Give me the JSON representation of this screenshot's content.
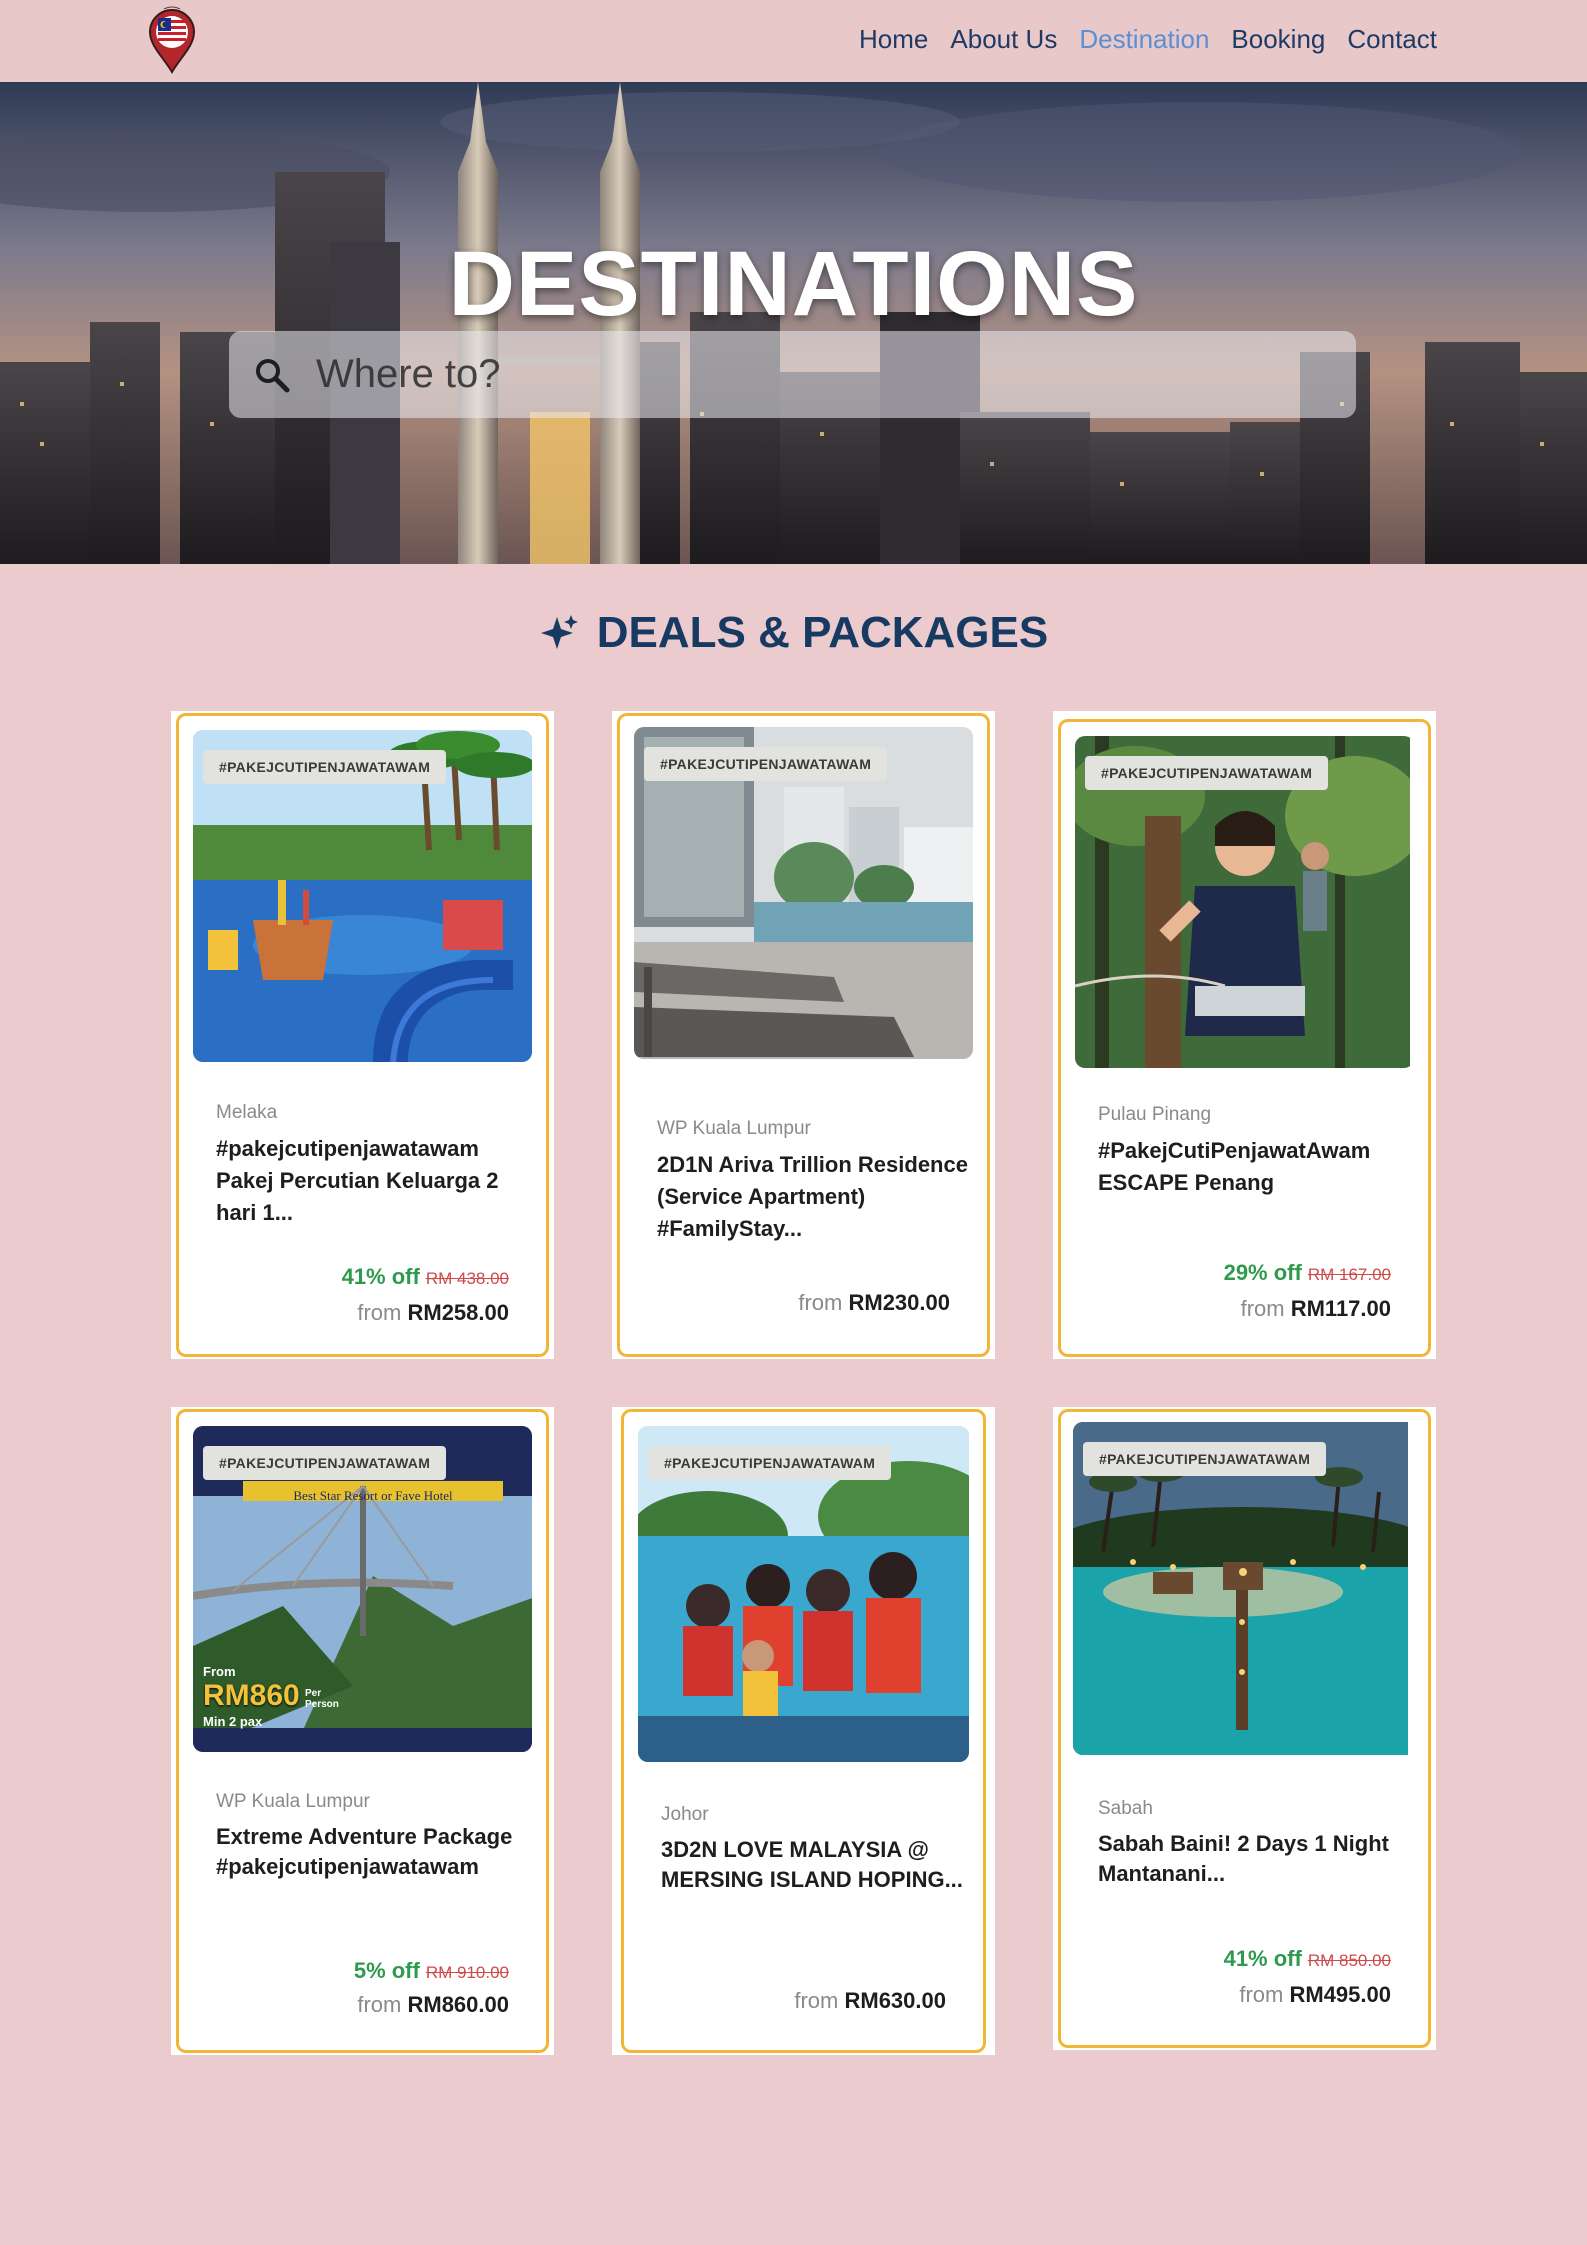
{
  "nav": {
    "links": [
      "Home",
      "About Us",
      "Destination",
      "Booking",
      "Contact"
    ],
    "active": "Destination"
  },
  "hero": {
    "title": "DESTINATIONS",
    "search_placeholder": "Where to?"
  },
  "section": {
    "title": "DEALS & PACKAGES"
  },
  "colors": {
    "accent": "#f2b636",
    "heading": "#173a63",
    "discount": "#2f9a4e",
    "strike": "#cf4a4a",
    "background": "#ebcbcd"
  },
  "cards": [
    {
      "tag": "#PAKEJCUTIPENJAWATAWAM",
      "location": "Melaka",
      "title": "#pakejcutipenjawatawam Pakej Percutian Keluarga 2 hari 1...",
      "discount": "41% off",
      "old_price": "RM 438.00",
      "from_label": "from",
      "price": "RM258.00",
      "image": "water-park"
    },
    {
      "tag": "#PAKEJCUTIPENJAWATAWAM",
      "location": "WP Kuala Lumpur",
      "title": "2D1N Ariva Trillion Residence (Service Apartment) #FamilyStay...",
      "discount": "",
      "old_price": "",
      "from_label": "from",
      "price": "RM230.00",
      "image": "pool-deck"
    },
    {
      "tag": "#PAKEJCUTIPENJAWATAWAM",
      "location": "Pulau Pinang",
      "title": "#PakejCutiPenjawatAwam ESCAPE Penang",
      "discount": "29% off",
      "old_price": "RM 167.00",
      "from_label": "from",
      "price": "RM117.00",
      "image": "forest-adventure"
    },
    {
      "tag": "#PAKEJCUTIPENJAWATAWAM",
      "location": "WP Kuala Lumpur",
      "title": "Extreme Adventure Package #pakejcutipenjawatawam",
      "discount": "5% off",
      "old_price": "RM 910.00",
      "from_label": "from",
      "price": "RM860.00",
      "image": "sky-bridge-poster",
      "poster_text": {
        "banner": "Best Star Resort or Fave Hotel",
        "from": "From",
        "amount": "RM860",
        "per": "Per Person",
        "min": "Min 2 pax"
      }
    },
    {
      "tag": "#PAKEJCUTIPENJAWATAWAM",
      "location": "Johor",
      "title": "3D2N LOVE MALAYSIA @ MERSING ISLAND HOPING...",
      "discount": "",
      "old_price": "",
      "from_label": "from",
      "price": "RM630.00",
      "image": "boat-group"
    },
    {
      "tag": "#PAKEJCUTIPENJAWATAWAM",
      "location": "Sabah",
      "title": "Sabah Baini! 2 Days 1 Night Mantanani...",
      "discount": "41% off",
      "old_price": "RM 850.00",
      "from_label": "from",
      "price": "RM495.00",
      "image": "island-jetty"
    }
  ]
}
